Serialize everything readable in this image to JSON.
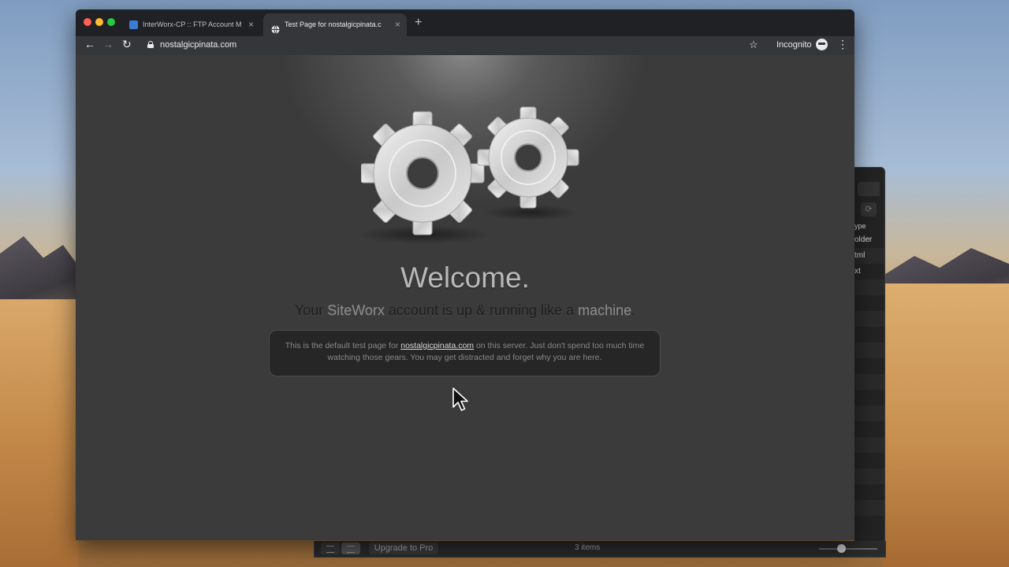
{
  "browser": {
    "tabs": [
      {
        "title": "InterWorx-CP :: FTP Account M",
        "favicon": "interworx-icon",
        "active": false
      },
      {
        "title": "Test Page for nostalgicpinata.c",
        "favicon": "globe-icon",
        "active": true
      }
    ],
    "new_tab": "+",
    "url": "nostalgicpinata.com",
    "incognito_label": "Incognito"
  },
  "page": {
    "welcome": "Welcome.",
    "tagline": {
      "part1": "Your ",
      "brand": "SiteWorx",
      "part2": " account is up & running like a ",
      "machine": "machine",
      "part3": "."
    },
    "info": {
      "text1": "This is the default test page for ",
      "link": "nostalgicpinata.com",
      "text2": " on this server. Just don't spend too much time watching those gears. You may get distracted and forget why you are here."
    }
  },
  "finder": {
    "column_header": "ype",
    "rows": [
      "older",
      "tml",
      "xt"
    ],
    "upgrade_label": "Upgrade to Pro",
    "item_count": "3 items"
  },
  "colors": {
    "tabstrip": "#202124",
    "toolbar": "#35363a",
    "page_bg": "#3b3b3b",
    "traffic_red": "#ff5f57",
    "traffic_yellow": "#febc2e",
    "traffic_green": "#28c840"
  }
}
